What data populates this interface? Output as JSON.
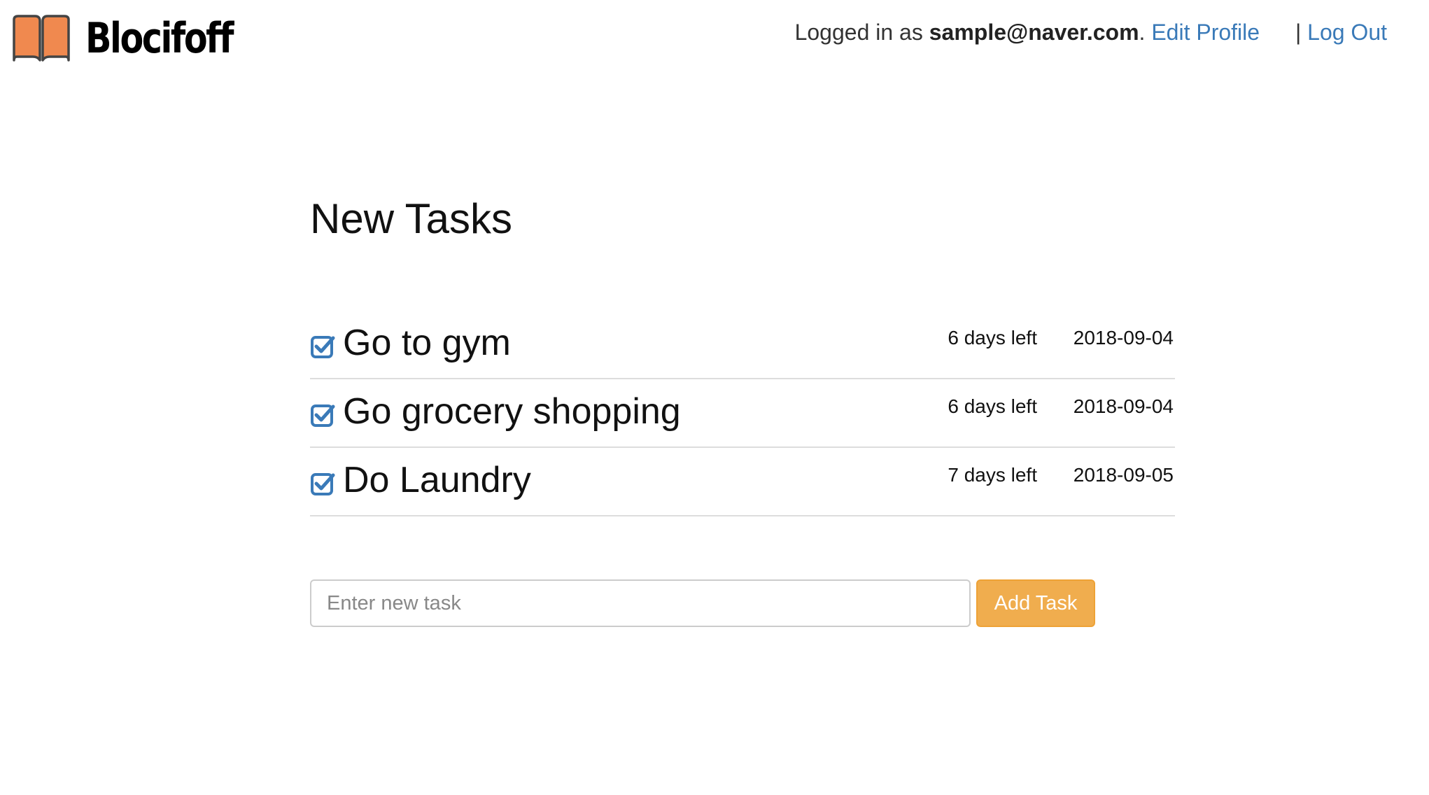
{
  "header": {
    "brand_name": "Blocifoff",
    "logged_in_prefix": "Logged in as",
    "user_email": "sample@naver.com",
    "email_suffix": ".",
    "edit_profile_label": "Edit Profile",
    "separator": "|",
    "logout_label": "Log Out",
    "logo_icon": "open-book-icon"
  },
  "main": {
    "title": "New Tasks",
    "tasks": [
      {
        "title": "Go to gym",
        "days_left": "6 days left",
        "due_date": "2018-09-04"
      },
      {
        "title": "Go grocery shopping",
        "days_left": "6 days left",
        "due_date": "2018-09-04"
      },
      {
        "title": "Do Laundry",
        "days_left": "7 days left",
        "due_date": "2018-09-05"
      }
    ],
    "form": {
      "input_value": "",
      "input_placeholder": "Enter new task",
      "submit_label": "Add Task"
    }
  },
  "colors": {
    "link": "#3a7ab8",
    "check_icon": "#3a7ab8",
    "add_button": "#f0ad4e",
    "logo_fill": "#f0894f"
  }
}
